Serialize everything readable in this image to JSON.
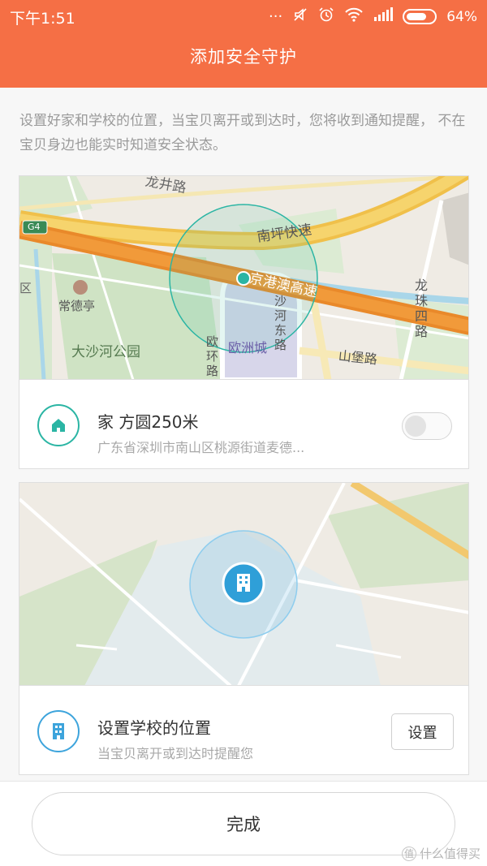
{
  "status_bar": {
    "time": "下午1:51",
    "battery": "64%",
    "icons": [
      "more-icon",
      "mute-icon",
      "alarm-icon",
      "wifi-icon",
      "signal-icon",
      "battery-icon"
    ]
  },
  "header": {
    "title": "添加安全守护"
  },
  "intro": "设置好家和学校的位置，当宝贝离开或到达时，您将收到通知提醒， 不在宝贝身边也能实时知道安全状态。",
  "home_map": {
    "labels": {
      "top_road": "龙井路",
      "highway_badge": "G4",
      "expressway": "南坪快速",
      "hk_road": "京港澳高速",
      "district": "区",
      "village": "常德亭",
      "park": "大沙河公园",
      "mall": "欧洲城",
      "shahe_road": "沙河东路",
      "ouhuan_road": "欧环路",
      "shanbao_road": "山堡路",
      "longzhu_road": "龙珠四路"
    }
  },
  "home": {
    "title": "家 方圆250米",
    "address": "广东省深圳市南山区桃源街道麦德...",
    "enabled": false,
    "accent": "#2bb5a4"
  },
  "school": {
    "title": "设置学校的位置",
    "subtitle": "当宝贝离开或到达时提醒您",
    "button": "设置",
    "accent": "#3da4dc"
  },
  "footer": {
    "done": "完成",
    "watermark": "什么值得买",
    "watermark_logo": "值"
  }
}
